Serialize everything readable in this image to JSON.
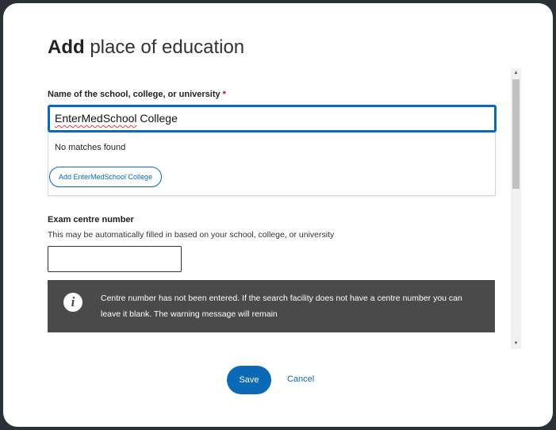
{
  "dialog": {
    "title_bold": "Add",
    "title_rest": "place of education"
  },
  "school_field": {
    "label": "Name of the school, college, or university",
    "required_marker": "*",
    "value_misspelled": "EnterMedSchool",
    "value_rest": " College"
  },
  "suggestions": {
    "no_matches": "No matches found",
    "add_button_label": "Add EnterMedSchool College"
  },
  "centre_field": {
    "label": "Exam centre number",
    "help": "This may be automatically filled in based on your school, college, or university",
    "value": ""
  },
  "warning": {
    "icon": "info-icon",
    "message": "Centre number has not been entered. If the search facility does not have a centre number you can leave it blank. The warning message will remain"
  },
  "actions": {
    "save_label": "Save",
    "cancel_label": "Cancel"
  },
  "colors": {
    "accent": "#0b6ab5",
    "warning_bg": "#4a4a4a",
    "required": "#d0021b"
  }
}
